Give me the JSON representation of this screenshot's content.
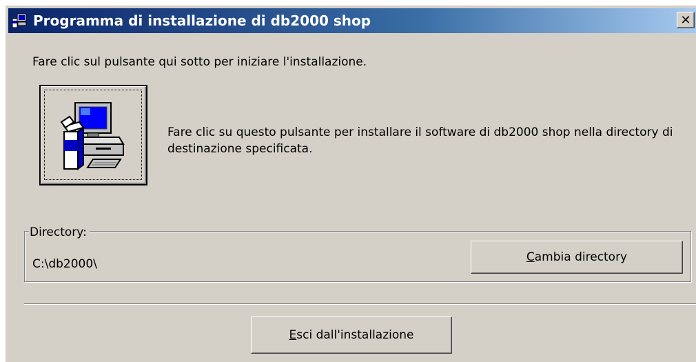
{
  "window": {
    "title": "Programma di installazione di db2000 shop",
    "close_glyph": "✕"
  },
  "instruction": "Fare clic sul pulsante qui sotto per iniziare l'installazione.",
  "install_button": {
    "icon": "computer-setup-icon",
    "description": "Fare clic su questo pulsante per installare il software di db2000 shop nella directory di destinazione specificata."
  },
  "directory_group": {
    "label": "Directory:",
    "value": "C:\\db2000\\",
    "change_button": {
      "mnemonic": "C",
      "rest": "ambia directory"
    }
  },
  "exit_button": {
    "mnemonic": "E",
    "rest": "sci dall'installazione"
  },
  "colors": {
    "face": "#d4d0c8",
    "title_start": "#0a246a",
    "title_end": "#a6caf0"
  }
}
